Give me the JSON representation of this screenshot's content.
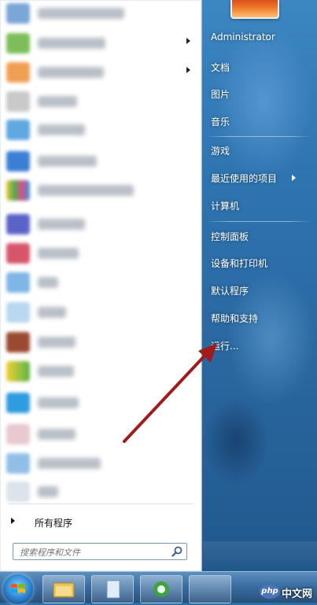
{
  "user": {
    "name": "Administrator"
  },
  "right_menu": {
    "documents": "文档",
    "pictures": "图片",
    "music": "音乐",
    "games": "游戏",
    "recent_items": "最近使用的项目",
    "computer": "计算机",
    "control_panel": "控制面板",
    "devices_printers": "设备和打印机",
    "default_programs": "默认程序",
    "help_support": "帮助和支持",
    "run": "运行..."
  },
  "left_menu": {
    "all_programs": "所有程序",
    "search_placeholder": "搜索程序和文件"
  },
  "colors": {
    "annotation_arrow": "#a01c1c",
    "left_panel_bg": "#ffffff",
    "desktop_blue": "#2e74b0"
  },
  "icons": [
    "windows-orb-icon",
    "search-icon",
    "submenu-arrow-icon",
    "explorer-icon",
    "ie-icon"
  ],
  "watermark": {
    "logo": "php",
    "text": "中文网"
  }
}
